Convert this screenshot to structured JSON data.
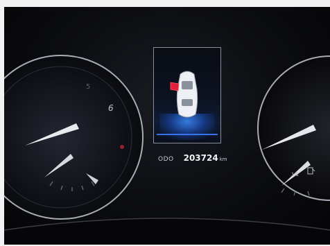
{
  "odometer": {
    "label": "ODO",
    "value": "203724",
    "unit": "km"
  },
  "gauges": {
    "tach_numbers": [
      "5",
      "6"
    ],
    "fuel_fraction_label": "1/2"
  },
  "door_warning": {
    "status": "front-left door open",
    "icon_color": "#e3203a"
  },
  "colors": {
    "display_accent": "#3d7cff",
    "needle": "#f1f1f1",
    "warning": "#e3203a"
  }
}
